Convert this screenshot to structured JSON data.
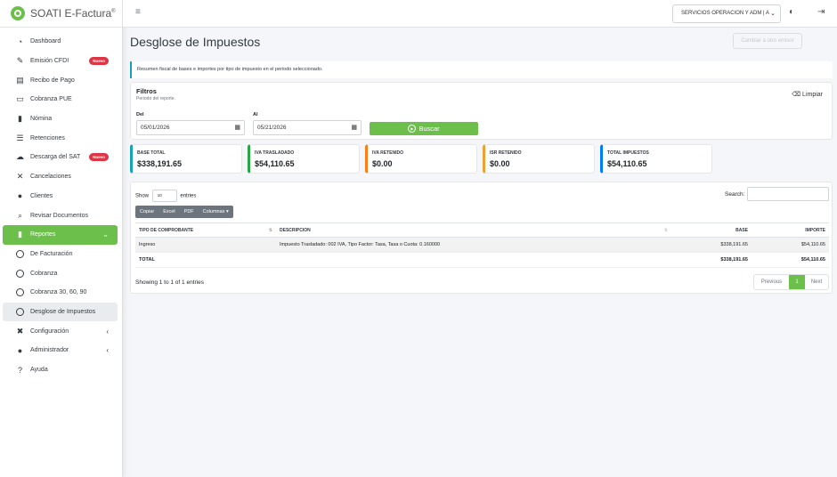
{
  "brand": {
    "name": "SOATI E-Factura",
    "mark": "®"
  },
  "sidebar": {
    "items": [
      {
        "label": "Dashboard",
        "icon": "dashboard-icon"
      },
      {
        "label": "Emisión CFDI",
        "icon": "file-signature-icon",
        "badge": "Nuevo"
      },
      {
        "label": "Recibo de Pago",
        "icon": "receipt-icon"
      },
      {
        "label": "Cobranza PUE",
        "icon": "money-icon"
      },
      {
        "label": "Nómina",
        "icon": "payroll-icon"
      },
      {
        "label": "Retenciones",
        "icon": "list-icon"
      },
      {
        "label": "Descarga del SAT",
        "icon": "cloud-download-icon",
        "badge": "Nuevo"
      },
      {
        "label": "Cancelaciones",
        "icon": "times-icon"
      },
      {
        "label": "Clientes",
        "icon": "user-icon"
      },
      {
        "label": "Revisar Documentos",
        "icon": "search-icon"
      },
      {
        "label": "Reportes",
        "icon": "report-icon",
        "active": true
      },
      {
        "label": "De Facturación",
        "icon": "circle-icon"
      },
      {
        "label": "Cobranza",
        "icon": "circle-icon"
      },
      {
        "label": "Cobranza 30, 60, 90",
        "icon": "circle-icon"
      },
      {
        "label": "Desglose de Impuestos",
        "icon": "circle-icon",
        "selected": true
      },
      {
        "label": "Configuración",
        "icon": "tools-icon"
      },
      {
        "label": "Administrador",
        "icon": "user-cog-icon"
      },
      {
        "label": "Ayuda",
        "icon": "question-icon"
      }
    ]
  },
  "topbar": {
    "company": "SERVICIOS OPERACION Y ADM | A"
  },
  "page": {
    "title": "Desglose de Impuestos",
    "ghost_button": "Cambiar a otro emisor",
    "callout": "Resumen fiscal de bases e importes por tipo de impuesto en el periodo seleccionado."
  },
  "filters": {
    "title": "Filtros",
    "subtitle": "Periodo del reporte.",
    "clear_label": "Limpiar",
    "from_label": "Del",
    "from_value": "05/01/2026",
    "to_label": "Al",
    "to_value": "05/21/2026",
    "search_label": "Buscar"
  },
  "summary": [
    {
      "label": "BASE TOTAL",
      "value": "$338,191.65",
      "color": "#17a2b8"
    },
    {
      "label": "IVA TRASLADADO",
      "value": "$54,110.65",
      "color": "#28a745"
    },
    {
      "label": "IVA RETENIDO",
      "value": "$0.00",
      "color": "#fd7e14"
    },
    {
      "label": "ISR RETENIDO",
      "value": "$0.00",
      "color": "#f0a030"
    },
    {
      "label": "TOTAL IMPUESTOS",
      "value": "$54,110.65",
      "color": "#007bff"
    }
  ],
  "table": {
    "show_label": "Show",
    "show_value": "10",
    "entries_label": "entries",
    "search_label": "Search:",
    "buttons": [
      "Copiar",
      "Excel",
      "PDF",
      "Columnas"
    ],
    "columns": [
      "TIPO DE COMPROBANTE",
      "DESCRIPCION",
      "BASE",
      "IMPORTE"
    ],
    "rows": [
      {
        "tipo": "Ingreso",
        "descripcion": "Impuesto Trasladado: 002 IVA, Tipo Factor: Tasa, Tasa o Cuota: 0.160000",
        "base": "$338,191.65",
        "importe": "$54,110.65"
      }
    ],
    "total": {
      "label": "TOTAL",
      "base": "$338,191.65",
      "importe": "$54,110.65"
    },
    "info": "Showing 1 to 1 of 1 entries",
    "pager": {
      "previous": "Previous",
      "current": "1",
      "next": "Next"
    }
  }
}
